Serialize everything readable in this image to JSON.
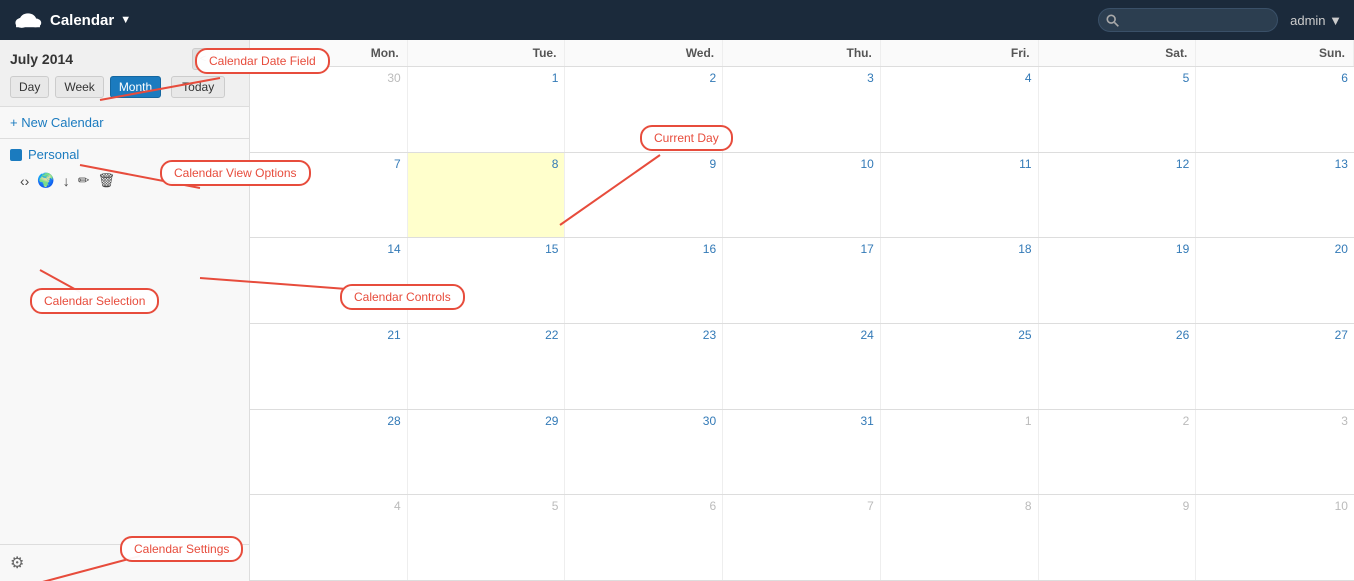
{
  "navbar": {
    "brand": "Calendar",
    "brand_caret": "▼",
    "search_placeholder": "",
    "admin_label": "admin ▼"
  },
  "sidebar": {
    "month_title": "July 2014",
    "prev_btn": "<",
    "next_btn": ">",
    "view_options": [
      "Day",
      "Week",
      "Month"
    ],
    "active_view": "Month",
    "today_btn": "Today",
    "new_calendar": "+ New Calendar",
    "calendars": [
      {
        "name": "Personal",
        "color": "#1b7bbf"
      }
    ],
    "controls": [
      "share-icon",
      "globe-icon",
      "download-icon",
      "edit-icon",
      "trash-icon"
    ],
    "settings_icon": "⚙"
  },
  "calendar": {
    "day_headers": [
      "Mon.",
      "Tue.",
      "Wed.",
      "Thu.",
      "Fri.",
      "Sat.",
      "Sun."
    ],
    "weeks": [
      [
        {
          "num": "30",
          "other": true
        },
        {
          "num": "1",
          "other": false
        },
        {
          "num": "2",
          "other": false
        },
        {
          "num": "3",
          "other": false
        },
        {
          "num": "4",
          "other": false
        },
        {
          "num": "5",
          "other": false
        },
        {
          "num": "6",
          "other": false
        }
      ],
      [
        {
          "num": "7",
          "other": false
        },
        {
          "num": "8",
          "other": false,
          "today": true
        },
        {
          "num": "9",
          "other": false
        },
        {
          "num": "10",
          "other": false
        },
        {
          "num": "11",
          "other": false
        },
        {
          "num": "12",
          "other": false
        },
        {
          "num": "13",
          "other": false
        }
      ],
      [
        {
          "num": "14",
          "other": false
        },
        {
          "num": "15",
          "other": false
        },
        {
          "num": "16",
          "other": false
        },
        {
          "num": "17",
          "other": false
        },
        {
          "num": "18",
          "other": false
        },
        {
          "num": "19",
          "other": false
        },
        {
          "num": "20",
          "other": false
        }
      ],
      [
        {
          "num": "21",
          "other": false
        },
        {
          "num": "22",
          "other": false
        },
        {
          "num": "23",
          "other": false
        },
        {
          "num": "24",
          "other": false
        },
        {
          "num": "25",
          "other": false
        },
        {
          "num": "26",
          "other": false
        },
        {
          "num": "27",
          "other": false
        }
      ],
      [
        {
          "num": "28",
          "other": false
        },
        {
          "num": "29",
          "other": false
        },
        {
          "num": "30",
          "other": false
        },
        {
          "num": "31",
          "other": false
        },
        {
          "num": "1",
          "other": true
        },
        {
          "num": "2",
          "other": true
        },
        {
          "num": "3",
          "other": true
        }
      ],
      [
        {
          "num": "4",
          "other": true
        },
        {
          "num": "5",
          "other": true
        },
        {
          "num": "6",
          "other": true
        },
        {
          "num": "7",
          "other": true
        },
        {
          "num": "8",
          "other": true
        },
        {
          "num": "9",
          "other": true
        },
        {
          "num": "10",
          "other": true
        }
      ]
    ]
  },
  "annotations": {
    "calendar_date_field": "Calendar Date Field",
    "calendar_view_options": "Calendar View Options",
    "current_day": "Current Day",
    "calendar_selection": "Calendar Selection",
    "calendar_controls": "Calendar Controls",
    "calendar_settings": "Calendar Settings"
  }
}
